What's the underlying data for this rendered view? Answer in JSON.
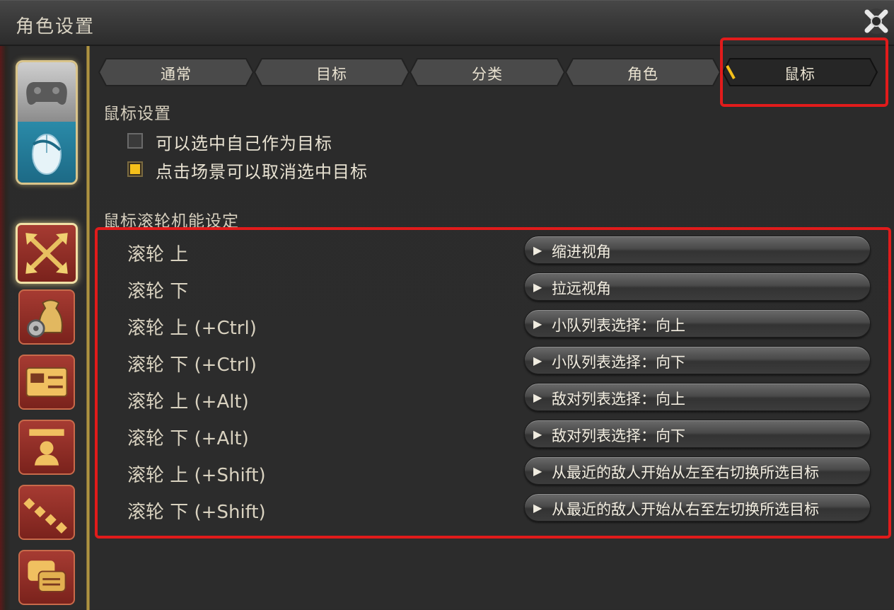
{
  "window": {
    "title": "角色设置"
  },
  "tabs": [
    {
      "label": "通常",
      "active": false
    },
    {
      "label": "目标",
      "active": false
    },
    {
      "label": "分类",
      "active": false
    },
    {
      "label": "角色",
      "active": false
    },
    {
      "label": "鼠标",
      "active": true
    }
  ],
  "mouse_settings": {
    "title": "鼠标设置",
    "options": [
      {
        "label": "可以选中自己作为目标",
        "checked": false
      },
      {
        "label": "点击场景可以取消选中目标",
        "checked": true
      }
    ]
  },
  "wheel_settings": {
    "title": "鼠标滚轮机能设定",
    "rows": [
      {
        "label": "滚轮 上",
        "action": "缩进视角"
      },
      {
        "label": "滚轮 下",
        "action": "拉远视角"
      },
      {
        "label": "滚轮 上 (+Ctrl)",
        "action": "小队列表选择：向上"
      },
      {
        "label": "滚轮 下 (+Ctrl)",
        "action": "小队列表选择：向下"
      },
      {
        "label": "滚轮 上 (+Alt)",
        "action": "敌对列表选择：向上"
      },
      {
        "label": "滚轮 下 (+Alt)",
        "action": "敌对列表选择：向下"
      },
      {
        "label": "滚轮 上 (+Shift)",
        "action": "从最近的敌人开始从左至右切换所选目标"
      },
      {
        "label": "滚轮 下 (+Shift)",
        "action": "从最近的敌人开始从右至左切换所选目标"
      }
    ]
  },
  "sidebar": {
    "device_modes": [
      "gamepad-icon",
      "mouse-icon"
    ],
    "items": [
      "move-arrows-icon",
      "bag-gear-icon",
      "id-card-icon",
      "profile-icon",
      "dotted-chain-icon",
      "chat-bubbles-icon"
    ]
  },
  "colors": {
    "highlight_box": "#e11b1b",
    "checkbox_checked": "#f5c01a",
    "nav_button": "#a63b32"
  }
}
